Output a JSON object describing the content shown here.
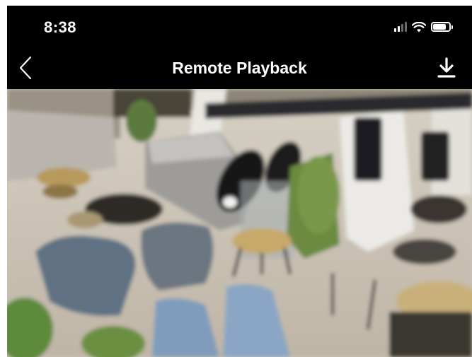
{
  "status_bar": {
    "time": "8:38",
    "icons": [
      "cellular-signal-icon",
      "wifi-icon",
      "battery-icon"
    ],
    "signal_bars": 4,
    "signal_bars_active": 2,
    "battery_level": 0.85
  },
  "nav": {
    "title": "Remote Playback",
    "back_icon": "chevron-left-icon",
    "download_icon": "download-icon"
  },
  "video": {
    "content": "camera-playback-frame"
  },
  "colors": {
    "background": "#000000",
    "text": "#ffffff",
    "page_background": "#ffffff"
  }
}
